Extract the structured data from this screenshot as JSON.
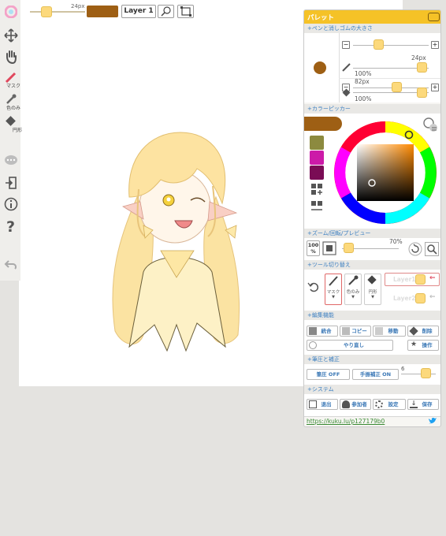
{
  "top_toolbar": {
    "brush_size_label": "24px",
    "layer_label": "Layer 1",
    "current_color": "#9e5f14"
  },
  "left_toolbar": {
    "items": [
      {
        "icon": "color-wheel-icon",
        "label": ""
      },
      {
        "icon": "move-icon",
        "label": ""
      },
      {
        "icon": "hand-icon",
        "label": ""
      },
      {
        "icon": "pen-icon",
        "label": "マスク"
      },
      {
        "icon": "eyedropper-icon",
        "label": "色のみ"
      },
      {
        "icon": "eraser-icon",
        "label": "円形"
      },
      {
        "icon": "chat-icon",
        "label": ""
      },
      {
        "icon": "exit-icon",
        "label": ""
      },
      {
        "icon": "info-icon",
        "label": ""
      },
      {
        "icon": "help-icon",
        "label": ""
      },
      {
        "icon": "undo-icon",
        "label": ""
      }
    ]
  },
  "palette": {
    "title": "パレット",
    "sections": {
      "pen_eraser_size": "+ペンと消しゴムの大きさ",
      "color_picker": "+カラーピッカー",
      "zoom": "+ズーム/回転/プレビュー",
      "tool_switch": "+ツール切り替え",
      "edit": "+編集機能",
      "pressure": "+筆圧と補正",
      "system": "+システム"
    },
    "pen": {
      "size_label": "24px",
      "opacity_label": "100%",
      "size_value": 24,
      "opacity_value": 100
    },
    "eraser": {
      "size_label": "82px",
      "opacity_label": "100%",
      "size_value": 82,
      "opacity_value": 100
    },
    "pen_color": "#9e5f14",
    "color_picker": {
      "current_color": "#9e5f14",
      "swatches": [
        "#8c8a3f",
        "#cc1aa8",
        "#7a0c55"
      ]
    },
    "zoom": {
      "level_label": "100",
      "level_unit": "%",
      "opacity_label": "70%",
      "opacity_value": 70
    },
    "tools": {
      "pen_label": "マスク",
      "eyedropper_label": "色のみ",
      "eraser_label": "円形",
      "layers": [
        "Layer1",
        "Layer2"
      ]
    },
    "edit": {
      "merge": "統合",
      "copy": "コピー",
      "move": "移動",
      "delete": "削除",
      "redo": "やり直し",
      "operation": "操作"
    },
    "pressure": {
      "pressure_off": "筆圧 OFF",
      "stabilizer_on": "手振補正 ON",
      "stabilizer_value": "6"
    },
    "system": {
      "exit": "退出",
      "participants": "参加者",
      "settings": "設定",
      "save": "保存"
    },
    "share_link": "https://kuku.lu/p127179b0"
  }
}
